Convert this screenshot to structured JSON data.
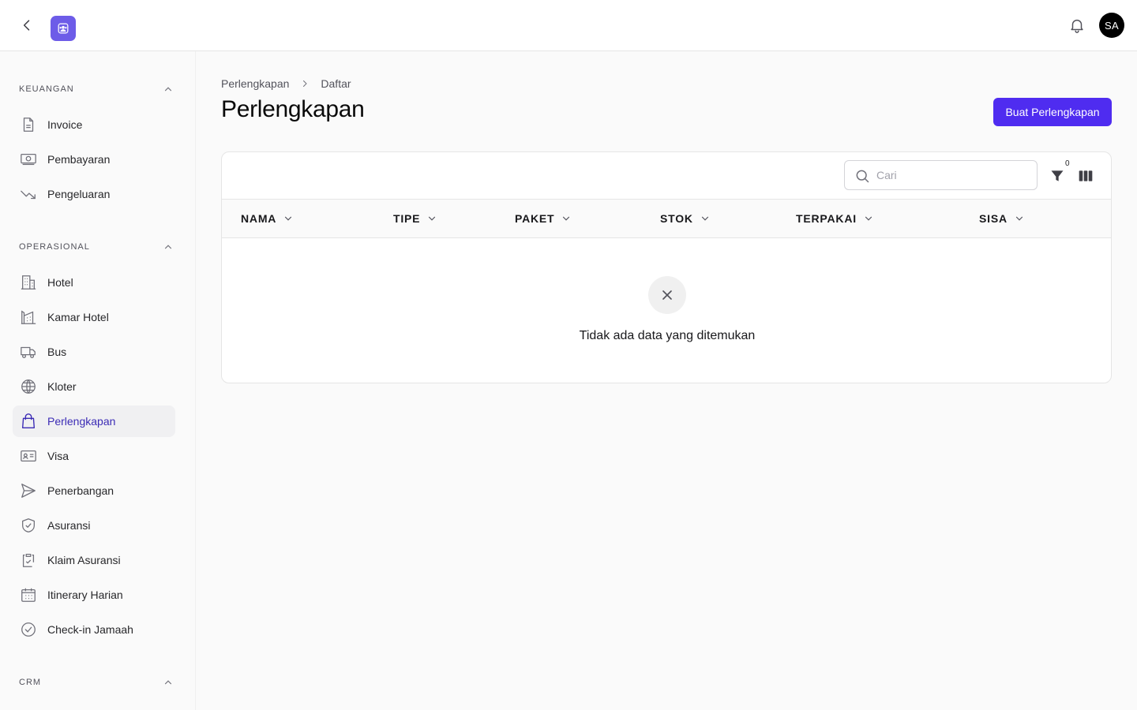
{
  "header": {
    "avatar_initials": "SA"
  },
  "sidebar": {
    "sections": [
      {
        "label": "KEUANGAN",
        "items": [
          {
            "label": "Invoice",
            "icon": "document-icon"
          },
          {
            "label": "Pembayaran",
            "icon": "cash-icon"
          },
          {
            "label": "Pengeluaran",
            "icon": "trend-down-icon"
          }
        ]
      },
      {
        "label": "OPERASIONAL",
        "items": [
          {
            "label": "Hotel",
            "icon": "building-icon"
          },
          {
            "label": "Kamar Hotel",
            "icon": "building-room-icon"
          },
          {
            "label": "Bus",
            "icon": "truck-icon"
          },
          {
            "label": "Kloter",
            "icon": "globe-icon"
          },
          {
            "label": "Perlengkapan",
            "icon": "shopping-bag-icon",
            "active": true
          },
          {
            "label": "Visa",
            "icon": "id-card-icon"
          },
          {
            "label": "Penerbangan",
            "icon": "paper-plane-icon"
          },
          {
            "label": "Asuransi",
            "icon": "shield-check-icon"
          },
          {
            "label": "Klaim Asuransi",
            "icon": "clipboard-check-icon"
          },
          {
            "label": "Itinerary Harian",
            "icon": "calendar-icon"
          },
          {
            "label": "Check-in Jamaah",
            "icon": "check-circle-icon"
          }
        ]
      },
      {
        "label": "CRM",
        "items": []
      }
    ]
  },
  "main": {
    "breadcrumb": [
      "Perlengkapan",
      "Daftar"
    ],
    "title": "Perlengkapan",
    "create_button": "Buat Perlengkapan",
    "search_placeholder": "Cari",
    "filter_count": "0",
    "columns": [
      "NAMA",
      "TIPE",
      "PAKET",
      "STOK",
      "TERPAKAI",
      "SISA"
    ],
    "empty_text": "Tidak ada data yang ditemukan"
  },
  "colors": {
    "accent": "#4f2cf0",
    "logo": "#6d5ce8",
    "active_text": "#3b2bb5"
  }
}
